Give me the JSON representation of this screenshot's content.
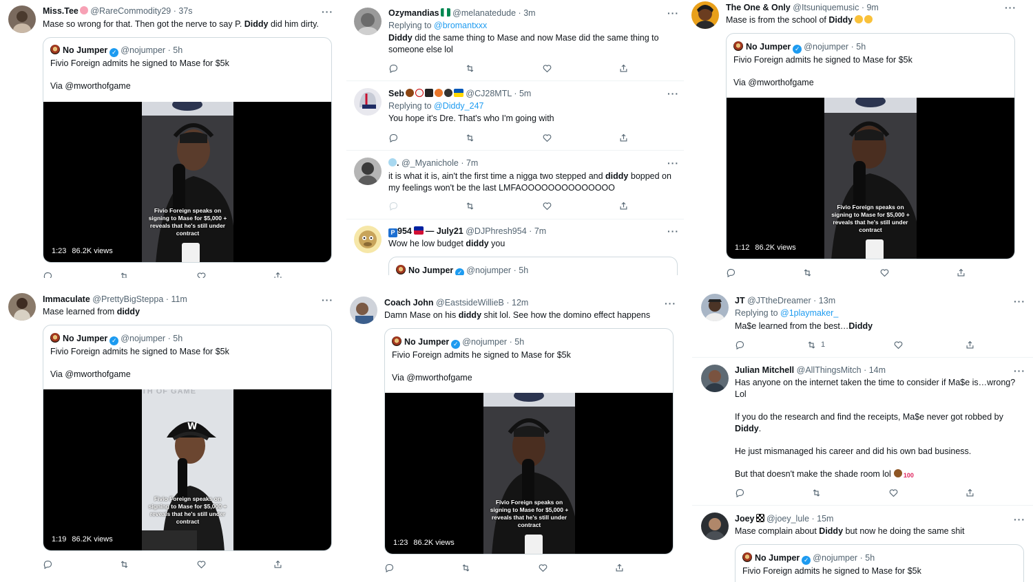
{
  "panels": {
    "p1": {
      "tweet": {
        "name": "Miss.Tee",
        "handle": "@RareCommodity29",
        "time": "37s",
        "text_before": "Mase so wrong for that. Then got the nerve to say P. ",
        "text_bold": "Diddy",
        "text_after": " did him dirty.",
        "quote": {
          "name": "No Jumper",
          "handle": "@nojumper",
          "time": "5h",
          "line1": "Fivio Foreign admits he signed to Mase for $5k",
          "line2": "Via @mworthofgame",
          "video_duration": "1:23",
          "video_views": "86.2K views",
          "caption": "Fivio Foreign speaks on signing to Mase for $5,000 + reveals that he's still under contract"
        }
      }
    },
    "p2": {
      "t1": {
        "name": "Ozymandias",
        "handle": "@melanatedude",
        "time": "3m",
        "reply_prefix": "Replying to ",
        "reply_to": "@bromantxxx",
        "text_bold": "Diddy",
        "text_after": " did the same thing to Mase and now Mase did the same thing to someone else lol"
      },
      "t2": {
        "name": "Seb",
        "handle": "@CJ28MTL",
        "time": "5m",
        "reply_prefix": "Replying to ",
        "reply_to": "@Diddy_247",
        "text": "You hope it's Dre. That's who I'm going with"
      },
      "t3": {
        "name": ".",
        "handle": "@_Myanichole",
        "time": "7m",
        "text_before": "it is what it is, ain't the first time a nigga two stepped and ",
        "text_bold": "diddy",
        "text_after": " bopped on my feelings won't be the last LMFAOOOOOOOOOOOOOO"
      },
      "t4": {
        "name": "954",
        "name_suffix": "— July21",
        "handle": "@DJPhresh954",
        "time": "7m",
        "text_before": "Wow he low budget ",
        "text_bold": "diddy",
        "text_after": " you",
        "quote": {
          "name": "No Jumper",
          "handle": "@nojumper",
          "time": "5h"
        }
      }
    },
    "p3": {
      "tweet": {
        "name": "The One & Only",
        "handle": "@Itsuniquemusic",
        "time": "9m",
        "text_before": "Mase is from the school of ",
        "text_bold": "Diddy",
        "quote": {
          "name": "No Jumper",
          "handle": "@nojumper",
          "time": "5h",
          "line1": "Fivio Foreign admits he signed to Mase for $5k",
          "line2": "Via @mworthofgame",
          "video_duration": "1:12",
          "video_views": "86.2K views",
          "caption": "Fivio Foreign speaks on signing to Mase for $5,000 + reveals that he's still under contract"
        }
      }
    },
    "p4": {
      "tweet": {
        "name": "Immaculate",
        "handle": "@PrettyBigSteppa",
        "time": "11m",
        "text_before": "Mase learned from ",
        "text_bold": "diddy",
        "quote": {
          "name": "No Jumper",
          "handle": "@nojumper",
          "time": "5h",
          "line1": "Fivio Foreign admits he signed to Mase for $5k",
          "line2": "Via @mworthofgame",
          "video_duration": "1:19",
          "video_views": "86.2K views",
          "caption": "Fivio Foreign speaks on signing to Mase for $5,000 + reveals that he's still under contract",
          "bg_text": "TH OF GAME"
        }
      }
    },
    "p5": {
      "tweet": {
        "name": "Coach John",
        "handle": "@EastsideWillieB",
        "time": "12m",
        "text_before": "Damn Mase on his ",
        "text_bold": "diddy",
        "text_after": " shit lol. See how the domino effect happens",
        "quote": {
          "name": "No Jumper",
          "handle": "@nojumper",
          "time": "5h",
          "line1": "Fivio Foreign admits he signed to Mase for $5k",
          "line2": "Via @mworthofgame",
          "video_duration": "1:23",
          "video_views": "86.2K views",
          "caption": "Fivio Foreign speaks on signing to Mase for $5,000 + reveals that he's still under contract"
        }
      }
    },
    "p6": {
      "t1": {
        "name": "JT",
        "handle": "@JTtheDreamer",
        "time": "13m",
        "reply_prefix": "Replying to ",
        "reply_to": "@1playmaker_",
        "text_before": "Ma$e learned from the best…",
        "text_bold": "Diddy",
        "retweet_count": "1"
      },
      "t2": {
        "name": "Julian Mitchell",
        "handle": "@AllThingsMitch",
        "time": "14m",
        "p1": "Has anyone on the internet taken the time to consider if Ma$e is…wrong? Lol",
        "p2_before": "If you do the research and find the receipts, Ma$e never got robbed by ",
        "p2_bold": "Diddy",
        "p2_after": ".",
        "p3": "He just mismanaged his career and did his own bad business.",
        "p4": "But that doesn't make the shade room lol"
      },
      "t3": {
        "name": "Joey",
        "handle": "@joey_lule",
        "time": "15m",
        "text_before": "Mase complain about ",
        "text_bold": "Diddy",
        "text_after": " but now he doing the same shit",
        "quote": {
          "name": "No Jumper",
          "handle": "@nojumper",
          "time": "5h",
          "line1": "Fivio Foreign admits he signed to Mase for $5k"
        }
      }
    }
  },
  "ui": {
    "more": "···",
    "dot": "·",
    "verified": "✓"
  },
  "colors": {
    "link": "#1d9bf0",
    "muted": "#536471",
    "border": "#cfd9de"
  }
}
